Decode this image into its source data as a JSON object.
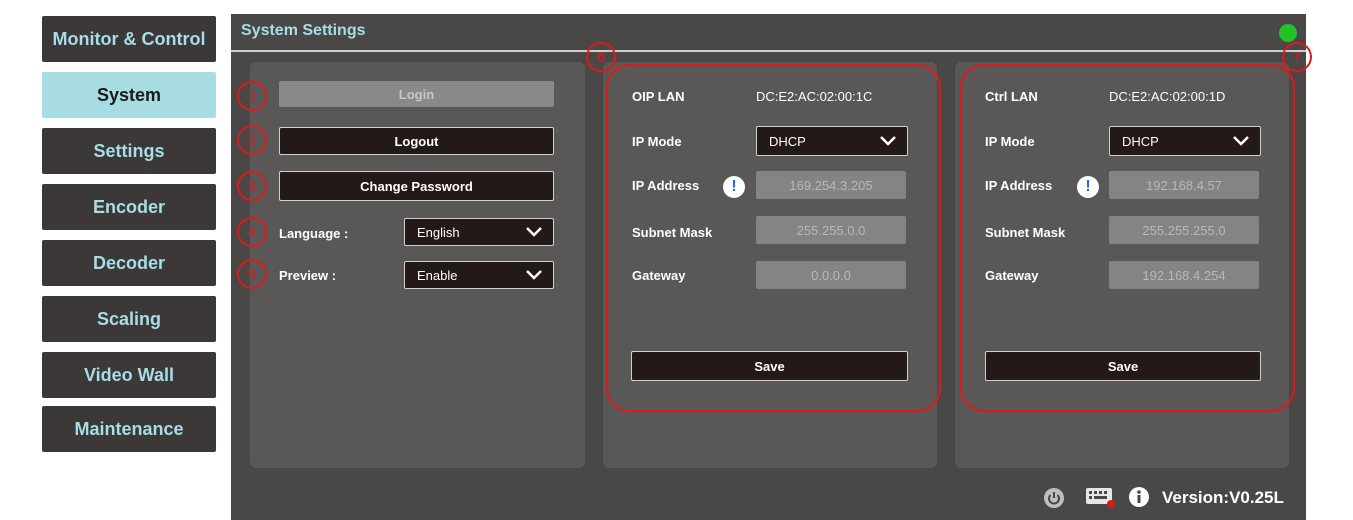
{
  "sidebar": {
    "items": [
      {
        "label": "Monitor & Control"
      },
      {
        "label": "System"
      },
      {
        "label": "Settings"
      },
      {
        "label": "Encoder"
      },
      {
        "label": "Decoder"
      },
      {
        "label": "Scaling"
      },
      {
        "label": "Video Wall"
      },
      {
        "label": "Maintenance"
      }
    ],
    "active_index": 1
  },
  "header": {
    "title": "System Settings",
    "status_color": "#22c22a"
  },
  "account": {
    "login_label": "Login",
    "logout_label": "Logout",
    "change_password_label": "Change Password",
    "language_label": "Language :",
    "language_value": "English",
    "preview_label": "Preview :",
    "preview_value": "Enable"
  },
  "oip_lan": {
    "name": "OIP LAN",
    "mac": "DC:E2:AC:02:00:1C",
    "ip_mode_label": "IP Mode",
    "ip_mode_value": "DHCP",
    "ip_address_label": "IP Address",
    "ip_address_value": "169.254.3.205",
    "subnet_label": "Subnet Mask",
    "subnet_value": "255.255.0.0",
    "gateway_label": "Gateway",
    "gateway_value": "0.0.0.0",
    "save_label": "Save"
  },
  "ctrl_lan": {
    "name": "Ctrl LAN",
    "mac": "DC:E2:AC:02:00:1D",
    "ip_mode_label": "IP Mode",
    "ip_mode_value": "DHCP",
    "ip_address_label": "IP Address",
    "ip_address_value": "192.168.4.57",
    "subnet_label": "Subnet Mask",
    "subnet_value": "255.255.255.0",
    "gateway_label": "Gateway",
    "gateway_value": "192.168.4.254",
    "save_label": "Save"
  },
  "annotations": [
    "1",
    "2",
    "3",
    "4",
    "5",
    "6",
    "7"
  ],
  "footer": {
    "icons": [
      "power-icon",
      "keyboard-icon",
      "info-icon"
    ],
    "version": "Version:V0.25L"
  },
  "colors": {
    "accent": "#a6dde6",
    "panel": "#4a4847",
    "annotation": "#dd1a1a"
  }
}
